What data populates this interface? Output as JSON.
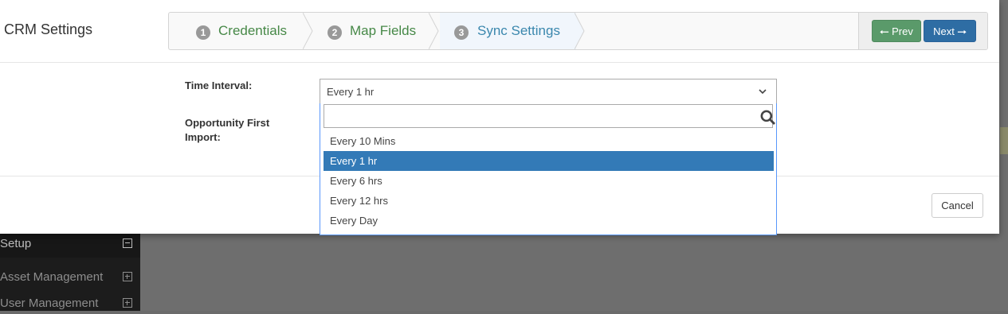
{
  "modal": {
    "title": "CRM Settings",
    "cancel_label": "Cancel"
  },
  "wizard": {
    "steps": [
      {
        "number": "1",
        "label": "Credentials",
        "state": "done"
      },
      {
        "number": "2",
        "label": "Map Fields",
        "state": "done"
      },
      {
        "number": "3",
        "label": "Sync Settings",
        "state": "active"
      }
    ],
    "prev_label": "Prev",
    "next_label": "Next"
  },
  "form": {
    "time_interval_label": "Time Interval:",
    "opportunity_label_line1": "Opportunity First",
    "opportunity_label_line2": "Import:",
    "time_interval_value": "Every 1 hr",
    "search_value": "",
    "options": [
      "Every 10 Mins",
      "Every 1 hr",
      "Every 6 hrs",
      "Every 12 hrs",
      "Every Day"
    ],
    "selected_option": "Every 1 hr"
  },
  "background_sidebar": {
    "items": [
      {
        "label": "Setup",
        "toggle": "minus"
      },
      {
        "label": "Asset Management",
        "toggle": "plus"
      },
      {
        "label": "User Management",
        "toggle": "plus"
      }
    ]
  },
  "colors": {
    "done_step": "#468847",
    "active_step": "#3a87ad",
    "selected_option_bg": "#337ab7",
    "next_button": "#2e6da4",
    "prev_button": "#5a9a6a"
  }
}
